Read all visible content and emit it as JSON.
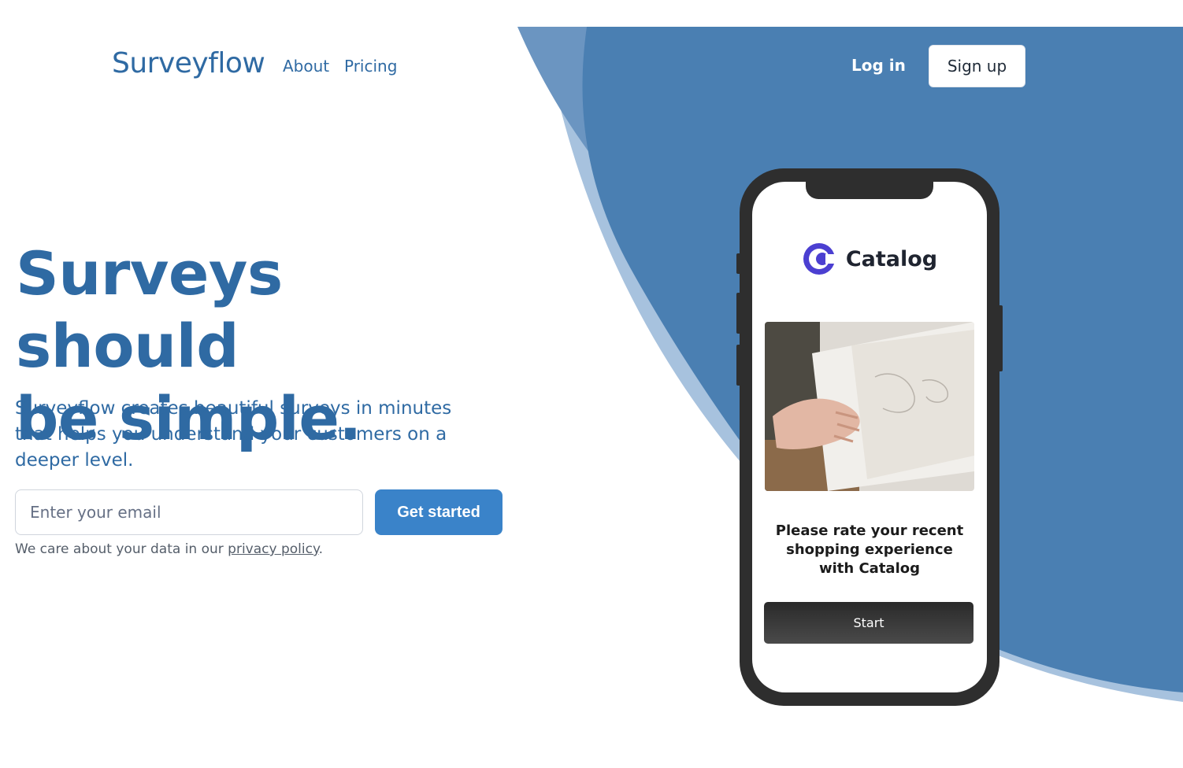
{
  "nav": {
    "logo": "Surveyflow",
    "links": [
      "About",
      "Pricing"
    ],
    "login": "Log in",
    "signup": "Sign up"
  },
  "hero": {
    "headline_line1": "Surveys should",
    "headline_line2": "be simple.",
    "subtitle": "Surveyflow creates beautiful surveys in minutes that helps you understand your customers on a deeper level.",
    "email_placeholder": "Enter your email",
    "cta": "Get started",
    "note_prefix": "We care about your data in our ",
    "note_link": "privacy policy",
    "note_suffix": "."
  },
  "phone": {
    "brand": "Catalog",
    "prompt": "Please rate your recent shopping experience with Catalog",
    "start": "Start"
  },
  "colors": {
    "primary_text": "#2f6aa3",
    "background_blob": "#4a7fb2",
    "background_blob_light": "#a7c2de",
    "cta": "#3a83c9",
    "brand_logo": "#4b3fd1"
  }
}
